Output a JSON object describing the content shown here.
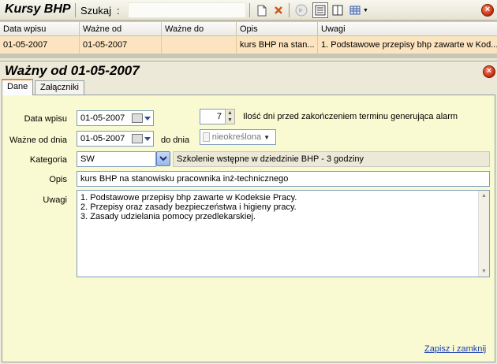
{
  "toolbar": {
    "title": "Kursy BHP",
    "search_label": "Szukaj",
    "search_colon": ":",
    "search_value": ""
  },
  "grid": {
    "columns": [
      "Data wpisu",
      "Ważne od",
      "Ważne do",
      "Opis",
      "Uwagi"
    ],
    "rows": [
      [
        "01-05-2007",
        "01-05-2007",
        "",
        "kurs BHP na stan...",
        "1. Podstawowe przepisy bhp zawarte w Kod..."
      ]
    ],
    "selected_row_color": "#fbe4bf"
  },
  "detail": {
    "title": "Ważny od 01-05-2007",
    "tabs": [
      "Dane",
      "Załączniki"
    ],
    "selected_tab": "Dane"
  },
  "form": {
    "data_wpisu_label": "Data wpisu",
    "data_wpisu_value": "01-05-2007",
    "alarm_days_value": "7",
    "alarm_days_label": "Ilość dni przed zakończeniem terminu generująca alarm",
    "wazne_od_label": "Ważne od dnia",
    "wazne_od_value": "01-05-2007",
    "do_dnia_label": "do dnia",
    "do_dnia_value": "nieokreślona",
    "kategoria_label": "Kategoria",
    "kategoria_code": "SW",
    "kategoria_name": "Szkolenie wstępne w dziedzinie BHP - 3 godziny",
    "opis_label": "Opis",
    "opis_value": "kurs BHP na stanowisku pracownika inż-technicznego",
    "uwagi_label": "Uwagi",
    "uwagi_lines": [
      "1. Podstawowe przepisy bhp zawarte w Kodeksie Pracy.",
      "2. Przepisy oraz zasady bezpieczeństwa i higieny pracy.",
      "3. Zasady udzielania pomocy przedlekarskiej."
    ],
    "save_link": "Zapisz i zamknij"
  },
  "colors": {
    "panel_bg": "#fafad2",
    "accent_close": "#c0290c",
    "link": "#1a3fb3"
  }
}
